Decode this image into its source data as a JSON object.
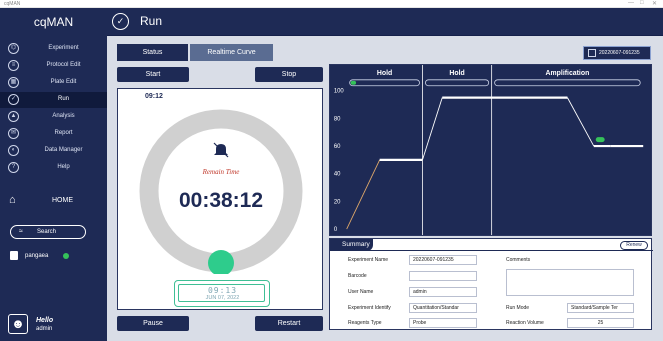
{
  "window": {
    "title": "cqMAN",
    "controls": [
      "—",
      "□",
      "✕"
    ]
  },
  "sidebar": {
    "brand": "cqMAN",
    "items": [
      {
        "label": "Experiment",
        "icon": "experiment-icon",
        "glyph": "⌬"
      },
      {
        "label": "Protocol Edit",
        "icon": "protocol-edit-icon",
        "glyph": "≡"
      },
      {
        "label": "Plate Edit",
        "icon": "plate-edit-icon",
        "glyph": "▦"
      },
      {
        "label": "Run",
        "icon": "run-icon",
        "glyph": "✓",
        "active": true
      },
      {
        "label": "Analysis",
        "icon": "analysis-icon",
        "glyph": "▲"
      },
      {
        "label": "Report",
        "icon": "report-icon",
        "glyph": "✉"
      },
      {
        "label": "Data Manager",
        "icon": "data-manager-icon",
        "glyph": "◐"
      },
      {
        "label": "Help",
        "icon": "help-icon",
        "glyph": "?"
      }
    ],
    "home_label": "HOME",
    "search_label": "Search",
    "device": {
      "name": "pangaea",
      "status_color": "#35c25a"
    },
    "user": {
      "greeting": "Hello",
      "name": "admin"
    }
  },
  "header": {
    "title": "Run"
  },
  "tabs": [
    {
      "label": "Status",
      "active": true
    },
    {
      "label": "Realtime Curve",
      "active": false
    }
  ],
  "experiment_button": {
    "label": "20220607-091235"
  },
  "controls": {
    "start": "Start",
    "stop": "Stop",
    "pause": "Pause",
    "restart": "Restart"
  },
  "timer": {
    "elapsed_label": "09:12",
    "remain_caption": "Remain Time",
    "remaining": "00:38:12",
    "progress_fraction": 0.5,
    "clock_time": "09:13",
    "clock_date": "JUN 07, 2022"
  },
  "chart_data": {
    "type": "line",
    "title": "",
    "xlabel": "",
    "ylabel": "",
    "ylim": [
      0,
      100
    ],
    "yticks": [
      0,
      20,
      40,
      60,
      80,
      100
    ],
    "stages": [
      {
        "name": "Hold",
        "progress": 0.08
      },
      {
        "name": "Hold",
        "progress": 0
      },
      {
        "name": "Amplification",
        "progress": 0
      }
    ],
    "profile": [
      {
        "x": 0,
        "y": 0
      },
      {
        "x": 10,
        "y": 50
      },
      {
        "x": 23,
        "y": 50
      },
      {
        "x": 29,
        "y": 95
      },
      {
        "x": 44,
        "y": 95
      },
      {
        "x": 67,
        "y": 95
      },
      {
        "x": 75,
        "y": 60
      },
      {
        "x": 80,
        "y": 60
      },
      {
        "x": 90,
        "y": 60
      }
    ],
    "completed_until_x": 4,
    "stage_boundaries_x": [
      23,
      44
    ],
    "xlim": [
      0,
      90
    ],
    "colors": {
      "completed": "#e0a86a",
      "pending": "#ffffff",
      "badge": "#35c25a"
    }
  },
  "summary": {
    "tab_label": "Summary",
    "renew_label": "Renew",
    "fields": {
      "experiment_name": {
        "label": "Experiment Name",
        "value": "20220607-091235"
      },
      "comments": {
        "label": "Comments",
        "value": ""
      },
      "barcode": {
        "label": "Barcode",
        "value": ""
      },
      "user_name": {
        "label": "User Name",
        "value": "admin"
      },
      "experiment_identify": {
        "label": "Experiment Identify",
        "value": "Quantitation/Standar"
      },
      "run_mode": {
        "label": "Run Mode",
        "value": "Standard/Sample Ter"
      },
      "reagents_type": {
        "label": "Reagents Type",
        "value": "Probe"
      },
      "reaction_volume": {
        "label": "Reaction Volume",
        "value": "25"
      }
    }
  }
}
